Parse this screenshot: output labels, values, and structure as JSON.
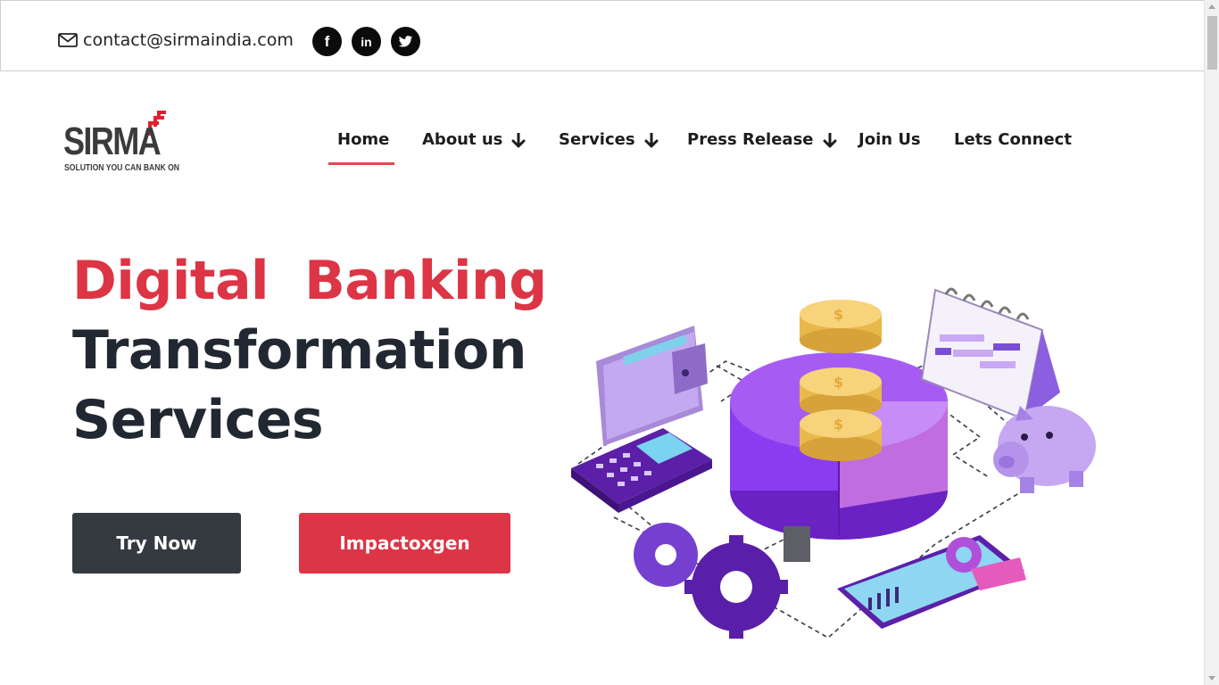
{
  "topbar": {
    "email": "contact@sirmaindia.com",
    "icons": [
      "envelope-icon",
      "facebook-icon",
      "linkedin-icon",
      "twitter-icon"
    ]
  },
  "logo": {
    "word": "SIRMA",
    "tagline": "SOLUTION YOU CAN BANK ON"
  },
  "nav": {
    "items": [
      {
        "label": "Home",
        "active": true,
        "dropdown": false
      },
      {
        "label": "About us",
        "active": false,
        "dropdown": true
      },
      {
        "label": "Services",
        "active": false,
        "dropdown": true
      },
      {
        "label": "Press Release",
        "active": false,
        "dropdown": true
      },
      {
        "label": "Join Us",
        "active": false,
        "dropdown": false
      },
      {
        "label": "Lets Connect",
        "active": false,
        "dropdown": false
      }
    ]
  },
  "hero": {
    "title_word1": "Digital",
    "title_word2": "Banking",
    "title_line2": "Transformation",
    "title_line3": "Services",
    "primary_button": "Try Now",
    "secondary_button": "Impactoxgen"
  },
  "colors": {
    "accent": "#dc3545",
    "dark": "#343a40",
    "text": "#222831",
    "illustration_purple": "#8a3df0"
  }
}
